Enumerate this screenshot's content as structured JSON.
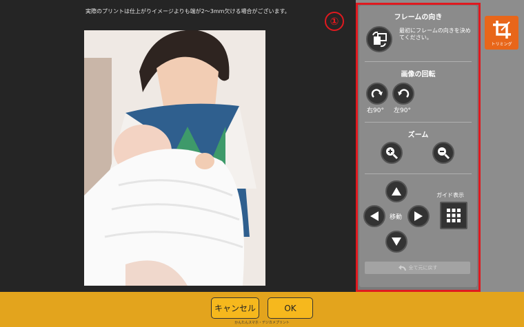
{
  "notice": "実際のプリントは仕上がりイメージよりも端が2～3mm欠ける場合がございます。",
  "marker": "①",
  "panel": {
    "orientation": {
      "title": "フレームの向き",
      "description": "最初にフレームの向きを決めてください。"
    },
    "rotation": {
      "title": "画像の回転",
      "right_label": "右90°",
      "left_label": "左90°"
    },
    "zoom": {
      "title": "ズーム"
    },
    "move": {
      "label": "移動",
      "guide_label": "ガイド表示"
    },
    "reset_label": "全て元に戻す"
  },
  "trim": {
    "label": "トリミング",
    "color": "#e8661a"
  },
  "footer": {
    "cancel_label": "キャンセル",
    "ok_label": "OK",
    "brand": "かんたんスマホ・デジカメプリント"
  },
  "colors": {
    "accent_red": "#e0191f",
    "footer_bg": "#e3a41d"
  }
}
